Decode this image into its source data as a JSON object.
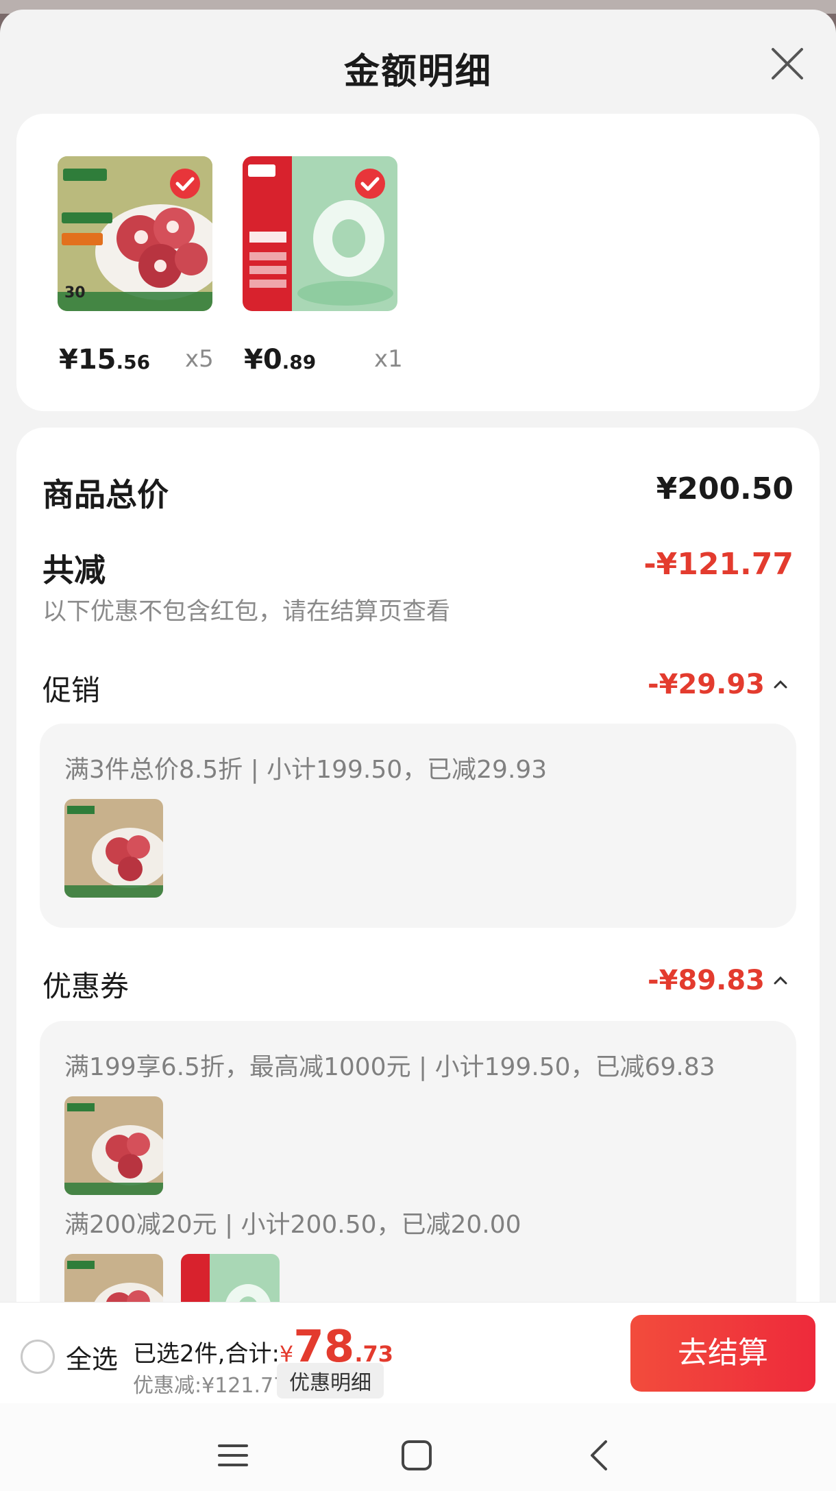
{
  "sheet": {
    "title": "金额明细",
    "products": [
      {
        "price_int": "¥15",
        "price_dec": ".56",
        "qty": "x5"
      },
      {
        "price_int": "¥0",
        "price_dec": ".89",
        "qty": "x1"
      }
    ]
  },
  "summary": {
    "total_label": "商品总价",
    "total_value": "¥200.50",
    "reduction_label": "共减",
    "reduction_value": "-¥121.77",
    "note": "以下优惠不包含红包，请在结算页查看"
  },
  "promotion": {
    "label": "促销",
    "value": "-¥29.93",
    "line": "满3件总价8.5折 | 小计199.50，已减29.93"
  },
  "coupon": {
    "label": "优惠券",
    "value": "-¥89.83",
    "line1": "满199享6.5折，最高减1000元 | 小计199.50，已减69.83",
    "line2": "满200减20元 | 小计200.50，已减20.00"
  },
  "bottom_bar": {
    "select_all": "全选",
    "selected_text": "已选2件,合计:",
    "total_yen": "¥",
    "total_int": "78",
    "total_dec": ".73",
    "discount_text": "优惠减:¥121.77",
    "detail_link": "优惠明细",
    "checkout_label": "去结算"
  },
  "icons": {
    "close": "close-icon",
    "check": "checkmark-icon",
    "chevron": "chevron-up-icon",
    "menu": "menu-icon",
    "home": "home-icon",
    "back": "back-icon"
  },
  "colors": {
    "accent_red": "#e33b2e",
    "checkout_gradient_start": "#f24c3c",
    "checkout_gradient_end": "#ee2a3b"
  }
}
